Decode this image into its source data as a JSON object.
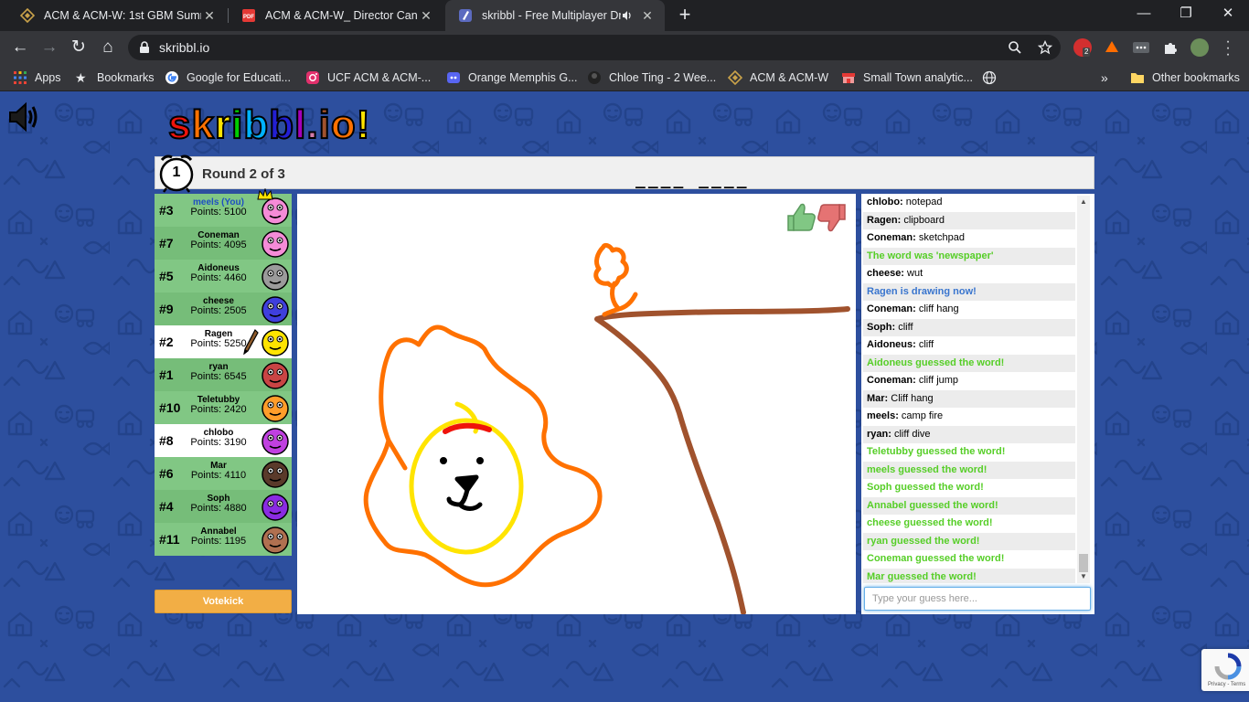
{
  "browser": {
    "tabs": [
      {
        "title": "ACM & ACM-W: 1st GBM Summ",
        "active": false
      },
      {
        "title": "ACM & ACM-W_ Director Candid",
        "active": false
      },
      {
        "title": "skribbl - Free Multiplayer Dra",
        "active": true
      }
    ],
    "url": "skribbl.io",
    "ext_badge": "2",
    "bookmarks": [
      "Apps",
      "Bookmarks",
      "Google for Educati...",
      "UCF ACM & ACM-...",
      "Orange Memphis G...",
      "Chloe Ting - 2 Wee...",
      "ACM & ACM-W",
      "Small Town analytic...",
      "Other bookmarks"
    ],
    "bookmarks_overflow": "»"
  },
  "logo": {
    "letters": [
      "s",
      "k",
      "r",
      "i",
      "b",
      "b",
      "l",
      ".",
      "i",
      "o",
      "!"
    ],
    "colors": [
      "#ef130b",
      "#ff7100",
      "#ffe400",
      "#00cc00",
      "#00b2ff",
      "#231fd3",
      "#a300ba",
      "#d37caa",
      "#a0522d",
      "#ff7100",
      "#ffe400"
    ]
  },
  "round": {
    "timer": "1",
    "label": "Round 2 of 3",
    "word_hint": "____ ____"
  },
  "players": [
    {
      "rank": "#3",
      "name": "meels (You)",
      "score": "Points: 5100",
      "is_me": true,
      "guessed": true,
      "avatar_color": "#f58bd7",
      "owner": true
    },
    {
      "rank": "#7",
      "name": "Coneman",
      "score": "Points: 4095",
      "guessed": true,
      "avatar_color": "#f58bd7"
    },
    {
      "rank": "#5",
      "name": "Aidoneus",
      "score": "Points: 4460",
      "guessed": true,
      "avatar_color": "#9b9b9b"
    },
    {
      "rank": "#9",
      "name": "cheese",
      "score": "Points: 2505",
      "guessed": true,
      "avatar_color": "#3f3fdd"
    },
    {
      "rank": "#2",
      "name": "Ragen",
      "score": "Points: 5250",
      "guessed": false,
      "drawing": true,
      "avatar_color": "#ffe400"
    },
    {
      "rank": "#1",
      "name": "ryan",
      "score": "Points: 6545",
      "guessed": true,
      "avatar_color": "#c94444"
    },
    {
      "rank": "#10",
      "name": "Teletubby",
      "score": "Points: 2420",
      "guessed": true,
      "avatar_color": "#ff9d2a"
    },
    {
      "rank": "#8",
      "name": "chlobo",
      "score": "Points: 3190",
      "guessed": false,
      "avatar_color": "#c040e0"
    },
    {
      "rank": "#6",
      "name": "Mar",
      "score": "Points: 4110",
      "guessed": true,
      "avatar_color": "#5a3a2a"
    },
    {
      "rank": "#4",
      "name": "Soph",
      "score": "Points: 4880",
      "guessed": true,
      "avatar_color": "#8a2be2"
    },
    {
      "rank": "#11",
      "name": "Annabel",
      "score": "Points: 1195",
      "guessed": true,
      "avatar_color": "#b07050"
    }
  ],
  "votekick_label": "Votekick",
  "chat": [
    {
      "name": "chlobo:",
      "text": " notepad"
    },
    {
      "name": "Ragen:",
      "text": " clipboard"
    },
    {
      "name": "Coneman:",
      "text": " sketchpad"
    },
    {
      "system": "The word was 'newspaper'",
      "color": "green"
    },
    {
      "name": "cheese:",
      "text": " wut"
    },
    {
      "system": "Ragen is drawing now!",
      "color": "blue"
    },
    {
      "name": "Coneman:",
      "text": " cliff hang"
    },
    {
      "name": "Soph:",
      "text": " cliff"
    },
    {
      "name": "Aidoneus:",
      "text": " cliff"
    },
    {
      "system": "Aidoneus guessed the word!",
      "color": "green"
    },
    {
      "name": "Coneman:",
      "text": " cliff jump"
    },
    {
      "name": "Mar:",
      "text": " Cliff hang"
    },
    {
      "name": "meels:",
      "text": " camp fire"
    },
    {
      "name": "ryan:",
      "text": " cliff dive"
    },
    {
      "system": "Teletubby guessed the word!",
      "color": "green"
    },
    {
      "system": "meels guessed the word!",
      "color": "green"
    },
    {
      "system": "Soph guessed the word!",
      "color": "green"
    },
    {
      "system": "Annabel guessed the word!",
      "color": "green"
    },
    {
      "system": "cheese guessed the word!",
      "color": "green"
    },
    {
      "system": "ryan guessed the word!",
      "color": "green"
    },
    {
      "system": "Coneman guessed the word!",
      "color": "green"
    },
    {
      "system": "Mar guessed the word!",
      "color": "green"
    }
  ],
  "guess_placeholder": "Type your guess here...",
  "recaptcha_text": "Privacy - Terms"
}
